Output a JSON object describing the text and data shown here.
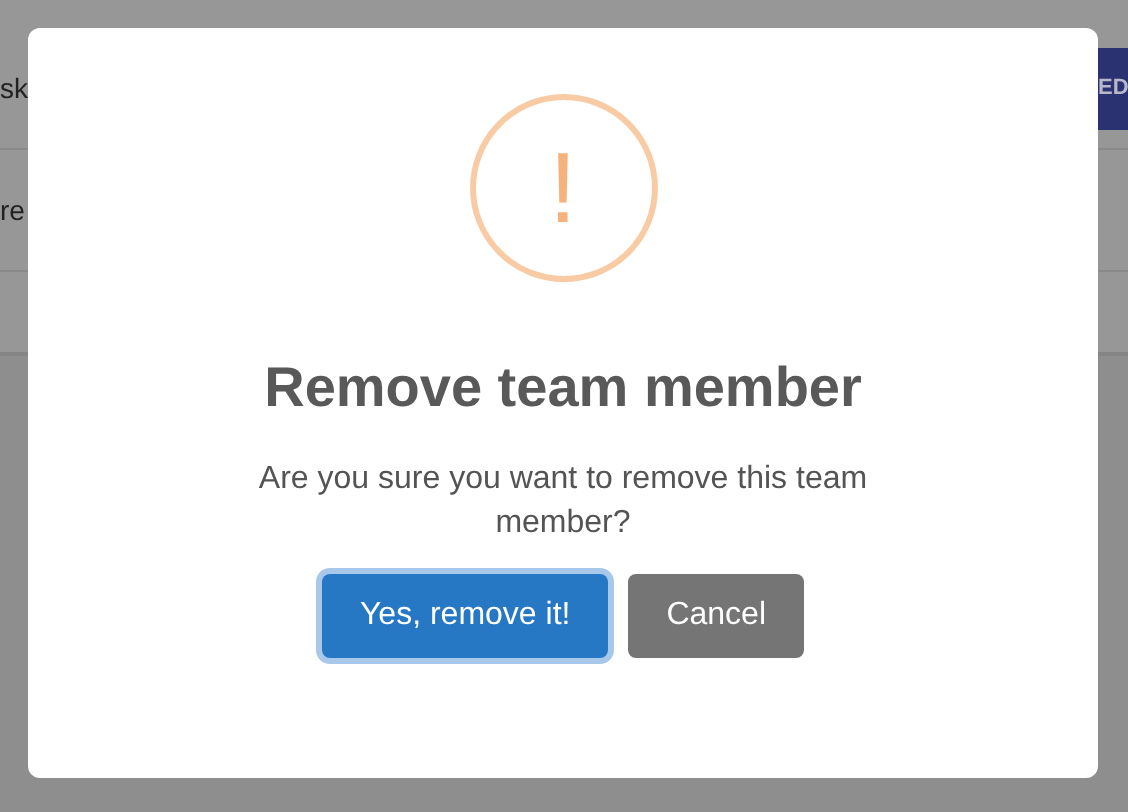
{
  "background": {
    "rows": [
      {
        "text": "sk"
      },
      {
        "text": "re"
      }
    ],
    "button": "ED"
  },
  "dialog": {
    "icon": {
      "glyph": "!"
    },
    "title": "Remove team member",
    "message": "Are you sure you want to remove this team member?",
    "buttons": [
      {
        "label": "Yes, remove it!",
        "kind": "confirm",
        "focused": true
      },
      {
        "label": "Cancel",
        "kind": "cancel",
        "focused": false
      }
    ]
  }
}
